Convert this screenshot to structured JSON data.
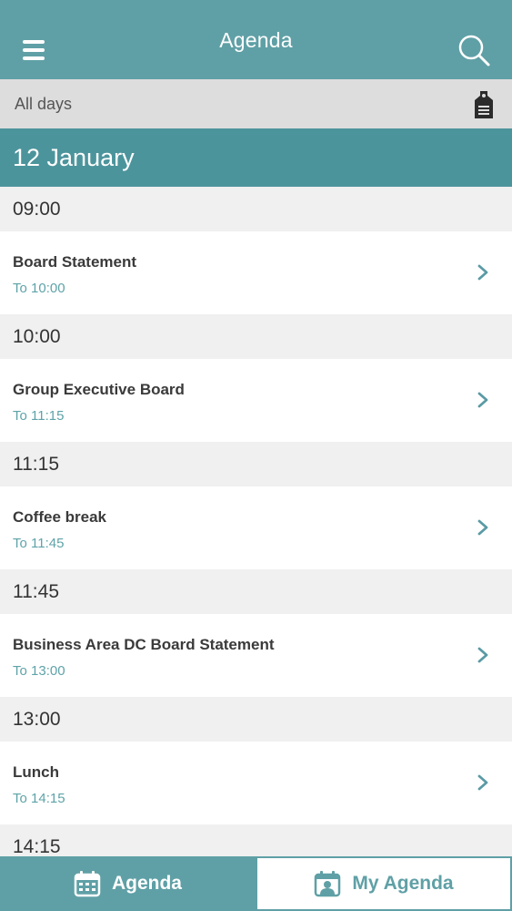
{
  "header": {
    "title": "Agenda",
    "menu_icon": "hamburger-menu-icon",
    "search_icon": "search-icon"
  },
  "filter": {
    "label": "All days",
    "tag_icon": "tag-icon"
  },
  "date_header": "12 January",
  "agenda": [
    {
      "time": "09:00",
      "title": "Board Statement",
      "end": "To 10:00"
    },
    {
      "time": "10:00",
      "title": "Group Executive Board",
      "end": "To 11:15"
    },
    {
      "time": "11:15",
      "title": "Coffee break",
      "end": "To 11:45"
    },
    {
      "time": "11:45",
      "title": "Business Area DC Board Statement",
      "end": "To 13:00"
    },
    {
      "time": "13:00",
      "title": "Lunch",
      "end": "To 14:15"
    }
  ],
  "partial_time": "14:15",
  "tabbar": {
    "agenda_label": "Agenda",
    "my_agenda_label": "My Agenda",
    "agenda_icon": "calendar-icon",
    "my_agenda_icon": "calendar-person-icon"
  },
  "colors": {
    "header": "#5fa0a6",
    "date_header": "#4c949c",
    "accent": "#5ea3a8",
    "filter_bar": "#dddddd",
    "time_slot": "#f0f0f0"
  }
}
